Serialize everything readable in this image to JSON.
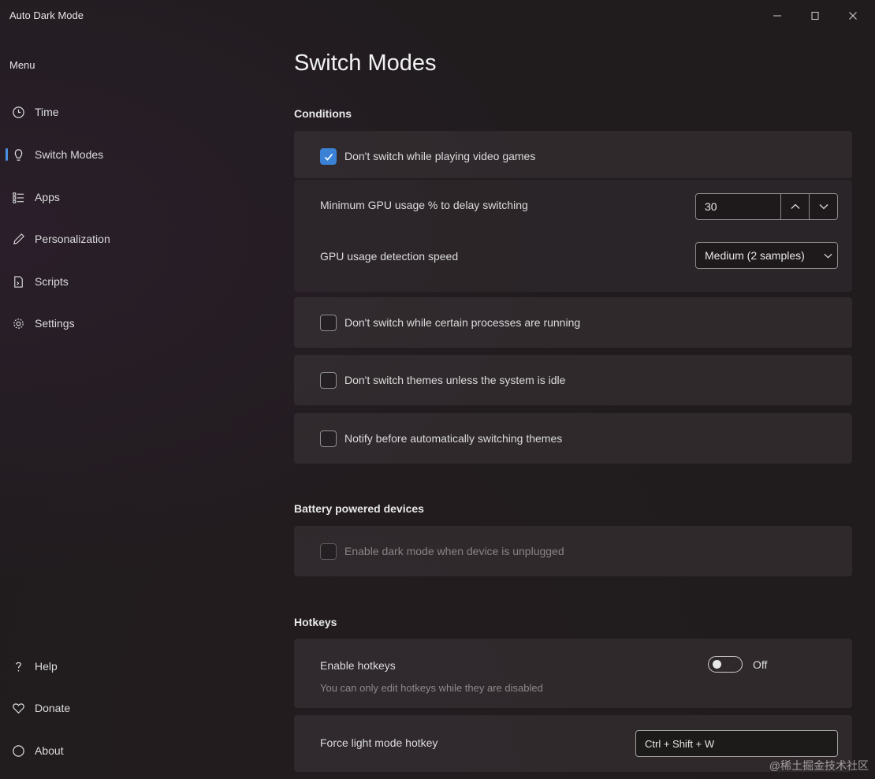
{
  "window": {
    "title": "Auto Dark Mode",
    "minimize_icon": "minimize-icon",
    "maximize_icon": "maximize-icon",
    "close_icon": "close-icon"
  },
  "sidebar": {
    "menu_label": "Menu",
    "items": [
      {
        "label": "Time",
        "icon": "clock-icon"
      },
      {
        "label": "Switch Modes",
        "icon": "switch-modes-icon",
        "active": true
      },
      {
        "label": "Apps",
        "icon": "apps-icon"
      },
      {
        "label": "Personalization",
        "icon": "pen-icon"
      },
      {
        "label": "Scripts",
        "icon": "script-icon"
      },
      {
        "label": "Settings",
        "icon": "gear-icon"
      }
    ],
    "footer_items": [
      {
        "label": "Help",
        "icon": "question-icon"
      },
      {
        "label": "Donate",
        "icon": "heart-icon"
      },
      {
        "label": "About",
        "icon": "info-icon"
      }
    ]
  },
  "main": {
    "page_title": "Switch Modes",
    "conditions": {
      "section_title": "Conditions",
      "games_checkbox": {
        "label": "Don't switch while playing video games",
        "checked": true
      },
      "gpu_min": {
        "label": "Minimum GPU usage % to delay switching",
        "value": "30"
      },
      "gpu_speed": {
        "label": "GPU usage detection speed",
        "value": "Medium (2 samples)"
      },
      "processes_checkbox": {
        "label": "Don't switch while certain processes are running",
        "checked": false
      },
      "idle_checkbox": {
        "label": "Don't switch themes unless the system is idle",
        "checked": false
      },
      "notify_checkbox": {
        "label": "Notify before automatically switching themes",
        "checked": false
      }
    },
    "battery": {
      "section_title": "Battery powered devices",
      "unplugged_checkbox": {
        "label": "Enable dark mode when device is unplugged",
        "checked": false,
        "disabled": true
      }
    },
    "hotkeys": {
      "section_title": "Hotkeys",
      "enable": {
        "label": "Enable hotkeys",
        "description": "You can only edit hotkeys while they are disabled",
        "state": "Off",
        "on": false
      },
      "force_light": {
        "label": "Force light mode hotkey",
        "value": "Ctrl + Shift + W"
      }
    }
  },
  "watermark": "@稀土掘金技术社区",
  "colors": {
    "accent": "#3b82d6",
    "background": "#201c1e",
    "card": "#3c3438"
  }
}
